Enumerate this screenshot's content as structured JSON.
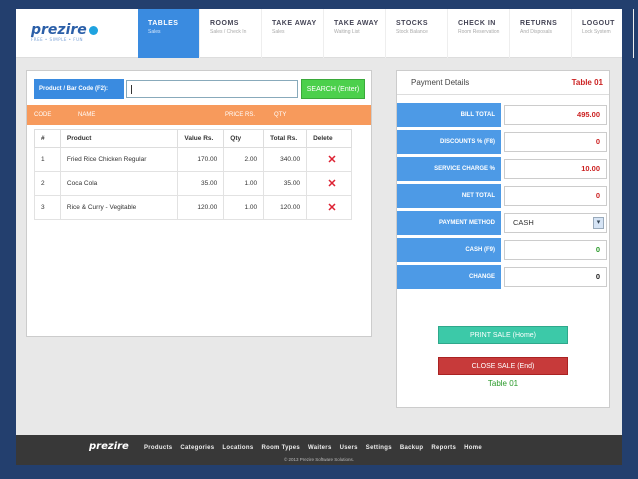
{
  "brand": {
    "logo": "prezire",
    "tagline": "FREE • SIMPLE • FUN"
  },
  "nav": [
    {
      "title": "TABLES",
      "sub": "Sales",
      "active": true
    },
    {
      "title": "ROOMS",
      "sub": "Sales / Check In"
    },
    {
      "title": "TAKE AWAY",
      "sub": "Sales"
    },
    {
      "title": "TAKE AWAY",
      "sub": "Waiting List"
    },
    {
      "title": "STOCKS",
      "sub": "Stock Balance"
    },
    {
      "title": "CHECK IN",
      "sub": "Room Reservation"
    },
    {
      "title": "RETURNS",
      "sub": "And Disposals"
    },
    {
      "title": "LOGOUT",
      "sub": "Lock System"
    }
  ],
  "search": {
    "label": "Product / Bar Code (F2):",
    "value": "",
    "button": "SEARCH (Enter)"
  },
  "orange_bar": {
    "code": "CODE",
    "name": "NAME",
    "price": "PRICE RS.",
    "qty": "QTY"
  },
  "table": {
    "headers": [
      "#",
      "Product",
      "Value Rs.",
      "Qty",
      "Total Rs.",
      "Delete"
    ],
    "rows": [
      {
        "no": "1",
        "product": "Fried Rice Chicken Regular",
        "value": "170.00",
        "qty": "2.00",
        "total": "340.00"
      },
      {
        "no": "2",
        "product": "Coca Cola",
        "value": "35.00",
        "qty": "1.00",
        "total": "35.00"
      },
      {
        "no": "3",
        "product": "Rice & Curry - Vegitable",
        "value": "120.00",
        "qty": "1.00",
        "total": "120.00"
      }
    ]
  },
  "payment": {
    "title": "Payment Details",
    "table_name": "Table 01",
    "rows": [
      {
        "label": "BILL TOTAL",
        "value": "495.00",
        "color": "red"
      },
      {
        "label": "DISCOUNTS % (F8)",
        "value": "0",
        "color": "red"
      },
      {
        "label": "SERVICE CHARGE %",
        "value": "10.00",
        "color": "red"
      },
      {
        "label": "NET TOTAL",
        "value": "0",
        "color": "red"
      },
      {
        "label": "PAYMENT METHOD",
        "value": "CASH",
        "color": "select"
      },
      {
        "label": "CASH (F9)",
        "value": "0",
        "color": "green"
      },
      {
        "label": "CHANGE",
        "value": "0",
        "color": "dark"
      }
    ],
    "print_button": "PRINT SALE (Home)",
    "close_button": "CLOSE SALE (End)",
    "footer_table": "Table 01"
  },
  "footer": {
    "logo": "prezire",
    "links": [
      "Products",
      "Categories",
      "Locations",
      "Room Types",
      "Waiters",
      "Users",
      "Settings",
      "Backup",
      "Reports",
      "Home"
    ],
    "copyright": "© 2013 Prezire Software Solutions."
  },
  "colors": {
    "accent": "#3a8be0",
    "orange": "#f79a5c",
    "search_green": "#4cd04c",
    "delete_red": "#d22233"
  }
}
